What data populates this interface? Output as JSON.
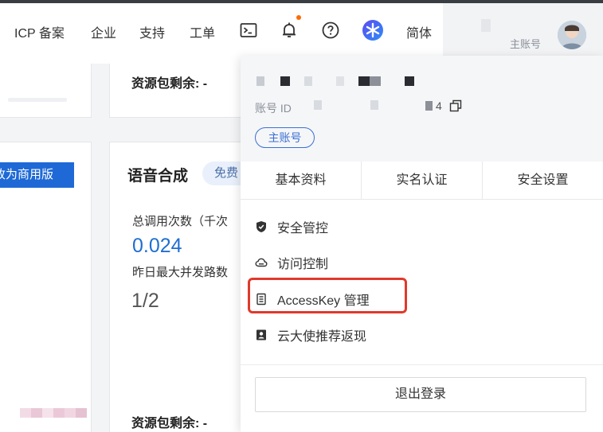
{
  "nav": {
    "items": [
      "ICP 备案",
      "企业",
      "支持",
      "工单"
    ],
    "terminal_icon": "terminal-icon",
    "bell_icon": "bell-icon",
    "help_icon": "help-circle-icon",
    "assistant_icon": "ai-assistant-icon",
    "language": "简体",
    "account_role": "主账号",
    "accent_color": "#ff6a00"
  },
  "background": {
    "upgrade_button": "改为商用版",
    "remaining_label_top": "资源包剩余: -",
    "tts_title": "语音合成",
    "free_badge": "免费",
    "calls_label": "总调用次数（千次",
    "calls_value": "0.024",
    "concurrency_label": "昨日最大并发路数",
    "concurrency_value": "1/2",
    "remaining_label_bottom": "资源包剩余: -"
  },
  "dropdown": {
    "account_id_label": "账号 ID",
    "account_id_tail": "4",
    "role_tag": "主账号",
    "tabs": [
      "基本资料",
      "实名认证",
      "安全设置"
    ],
    "menu": [
      {
        "label": "安全管控",
        "icon": "shield-icon"
      },
      {
        "label": "访问控制",
        "icon": "cloud-icon"
      },
      {
        "label": "AccessKey 管理",
        "icon": "key-icon"
      },
      {
        "label": "云大使推荐返现",
        "icon": "ambassador-icon"
      }
    ],
    "logout": "退出登录",
    "highlight_color": "#e0392b",
    "link_color": "#3b6fd4"
  }
}
